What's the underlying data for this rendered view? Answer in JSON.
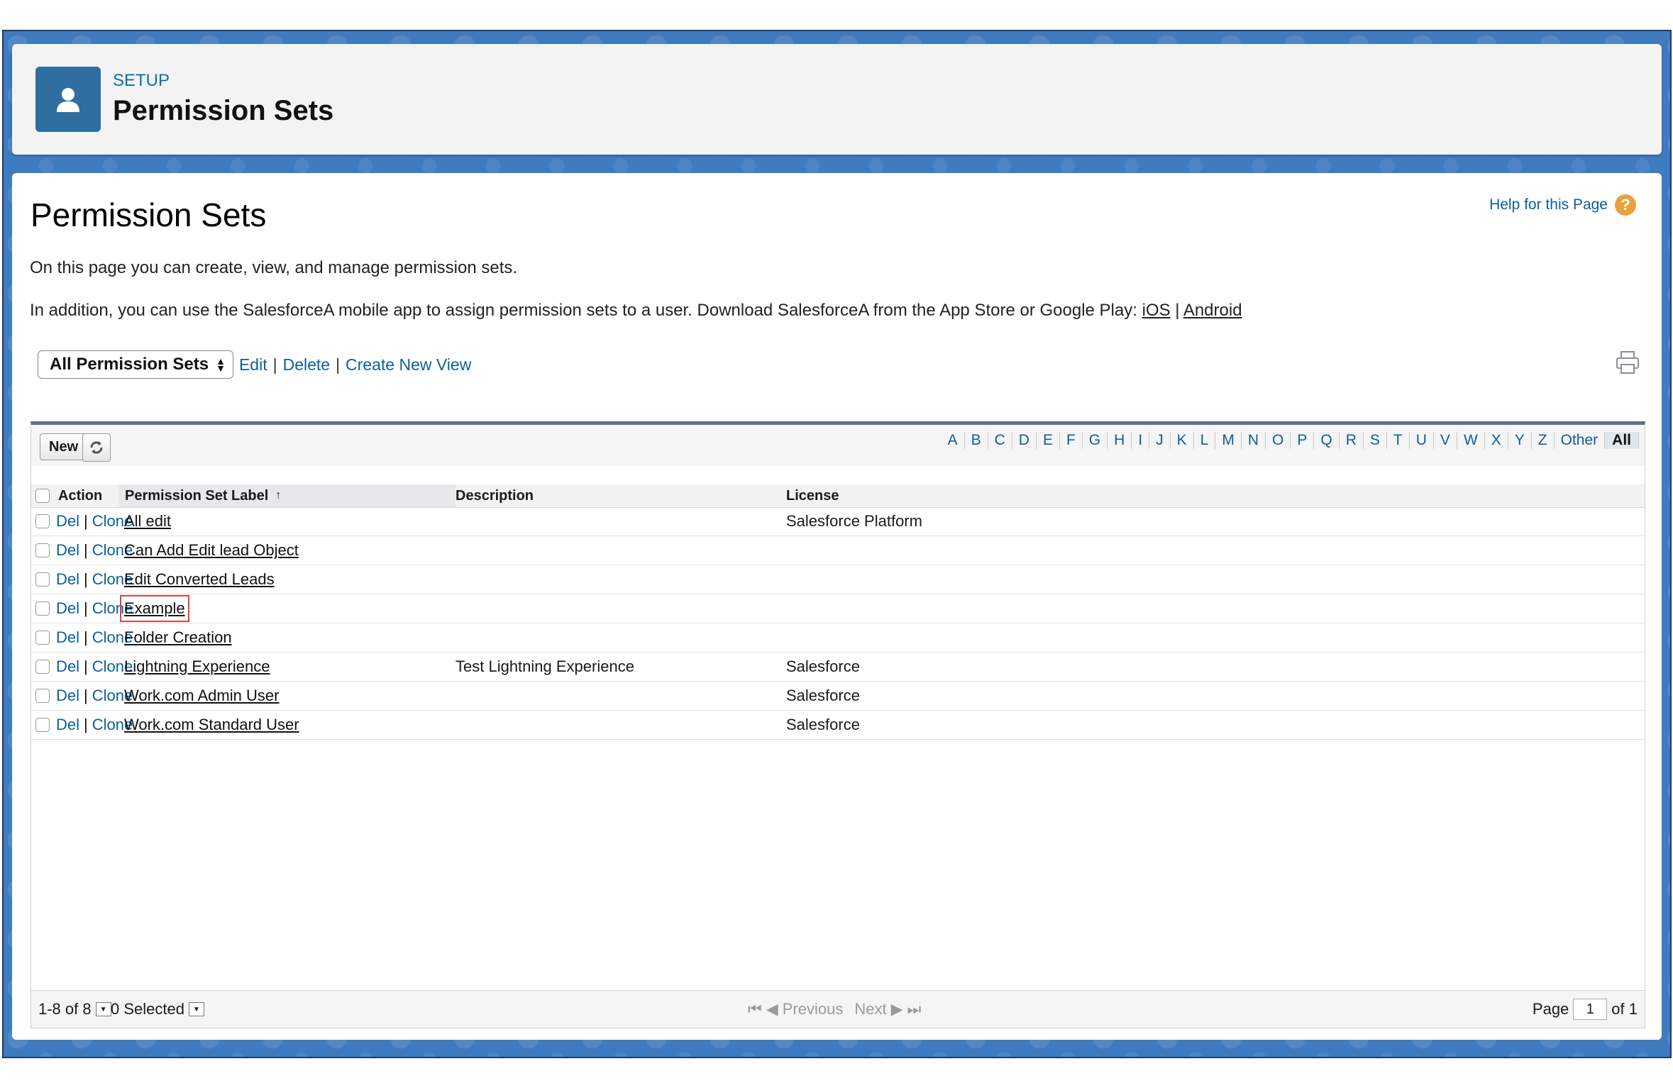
{
  "header": {
    "setup_label": "SETUP",
    "title": "Permission Sets"
  },
  "page": {
    "heading": "Permission Sets",
    "help_link": "Help for this Page",
    "description1": "On this page you can create, view, and manage permission sets.",
    "description2": "In addition, you can use the SalesforceA mobile app to assign permission sets to a user. Download SalesforceA from the App Store or Google Play:",
    "ios_link": "iOS",
    "android_link": "Android",
    "link_sep": "|"
  },
  "view": {
    "selected": "All Permission Sets",
    "edit": "Edit",
    "delete": "Delete",
    "create": "Create New View",
    "sep": "|"
  },
  "toolbar": {
    "new_label": "New",
    "alphabet": [
      "A",
      "B",
      "C",
      "D",
      "E",
      "F",
      "G",
      "H",
      "I",
      "J",
      "K",
      "L",
      "M",
      "N",
      "O",
      "P",
      "Q",
      "R",
      "S",
      "T",
      "U",
      "V",
      "W",
      "X",
      "Y",
      "Z",
      "Other",
      "All"
    ]
  },
  "table": {
    "headers": {
      "action": "Action",
      "label": "Permission Set Label",
      "sort_arrow": "↑",
      "description": "Description",
      "license": "License"
    },
    "action_del": "Del",
    "action_sep": "|",
    "action_clone": "Clone",
    "rows": [
      {
        "label": "All edit",
        "description": "",
        "license": "Salesforce Platform"
      },
      {
        "label": "Can Add Edit lead Object",
        "description": "",
        "license": ""
      },
      {
        "label": "Edit Converted Leads",
        "description": "",
        "license": ""
      },
      {
        "label": "Example",
        "description": "",
        "license": "",
        "highlighted": true
      },
      {
        "label": "Folder Creation",
        "description": "",
        "license": ""
      },
      {
        "label": "Lightning Experience",
        "description": "Test Lightning Experience",
        "license": "Salesforce"
      },
      {
        "label": "Work.com Admin User",
        "description": "",
        "license": "Salesforce"
      },
      {
        "label": "Work.com Standard User",
        "description": "",
        "license": "Salesforce"
      }
    ]
  },
  "footer": {
    "range": "1-8 of 8",
    "selected": "0 Selected",
    "previous": "Previous",
    "next": "Next",
    "page_label": "Page",
    "page_value": "1",
    "of_label": "of 1"
  },
  "colors": {
    "link": "#0b5f99",
    "brand_blue": "#2f6ea1",
    "highlight_border": "#d24a3a",
    "help_icon": "#e8a23c"
  }
}
